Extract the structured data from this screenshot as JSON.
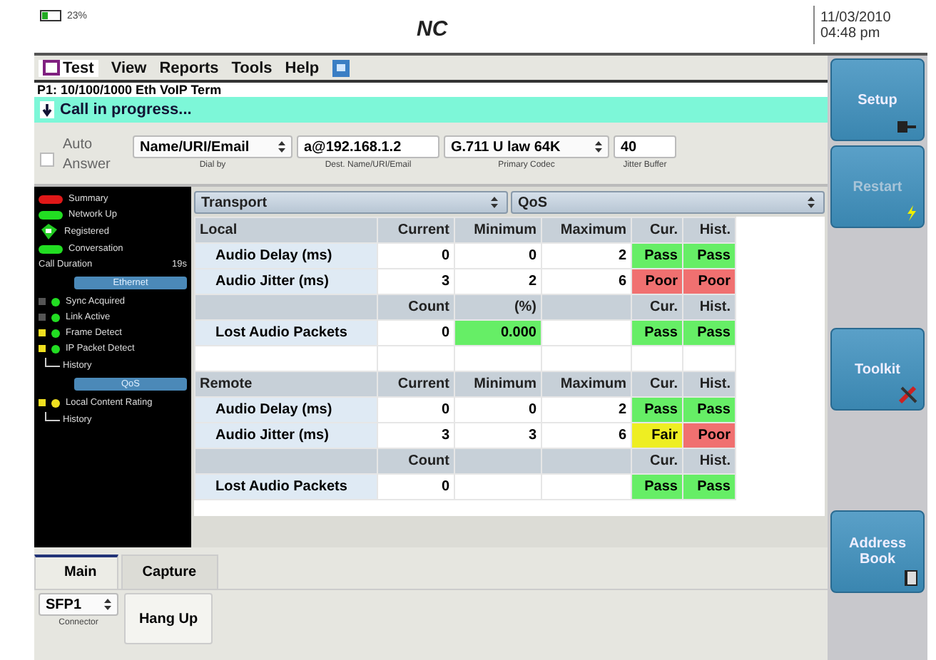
{
  "top_bar": {
    "battery": "23%",
    "logo": "NC",
    "date": "11/03/2010",
    "time": "04:48 pm"
  },
  "menu": [
    {
      "label": "Test",
      "selected": true
    },
    {
      "label": "View",
      "selected": false
    },
    {
      "label": "Reports",
      "selected": false
    },
    {
      "label": "Tools",
      "selected": false
    },
    {
      "label": "Help",
      "selected": false
    }
  ],
  "title": "P1: 10/100/1000 Eth VoIP Term",
  "status": "Call in progress...",
  "form": {
    "auto_answer": {
      "label": "Auto Answer",
      "checked": false
    },
    "fields": [
      {
        "kind": "select",
        "value": "Name/URI/Email",
        "caption": "Dial by"
      },
      {
        "kind": "text",
        "value": "a@192.168.1.2",
        "caption": "Dest. Name/URI/Email"
      },
      {
        "kind": "select",
        "value": "G.711 U law 64K",
        "caption": "Primary Codec"
      },
      {
        "kind": "text",
        "value": "40",
        "caption": "Jitter Buffer"
      }
    ]
  },
  "sidebar": [
    {
      "kind": "pill",
      "label": "Summary",
      "color": "#e01818"
    },
    {
      "kind": "pill",
      "label": "Network Up",
      "color": "#22dd22"
    },
    {
      "kind": "phone",
      "label": "Registered"
    },
    {
      "kind": "pill",
      "label": "Conversation",
      "color": "#22dd22"
    },
    {
      "kind": "value",
      "label": "Call Duration",
      "value": "19s"
    },
    {
      "kind": "section",
      "label": "Ethernet"
    },
    {
      "kind": "led",
      "label": "Sync Acquired",
      "history_alarm": false,
      "color": "#22dd22"
    },
    {
      "kind": "led",
      "label": "Link Active",
      "history_alarm": false,
      "color": "#22dd22"
    },
    {
      "kind": "led",
      "label": "Frame Detect",
      "history_alarm": true,
      "color": "#22dd22"
    },
    {
      "kind": "led",
      "label": "IP Packet Detect",
      "history_alarm": true,
      "color": "#22dd22"
    },
    {
      "kind": "history",
      "label": "History"
    },
    {
      "kind": "section",
      "label": "QoS"
    },
    {
      "kind": "led",
      "label": "Local Content Rating",
      "history_alarm": true,
      "color": "#f0e020"
    },
    {
      "kind": "history",
      "label": "History"
    }
  ],
  "selectors": [
    "Transport",
    "QoS"
  ],
  "table": {
    "rows": [
      {
        "kind": "header",
        "cells": [
          "Local",
          "Current",
          "Minimum",
          "Maximum",
          "Cur.",
          "Hist."
        ]
      },
      {
        "kind": "data",
        "cells": [
          "Audio Delay (ms)",
          "0",
          "0",
          "2"
        ],
        "results": [
          {
            "text": "Pass",
            "color": "#66ee66"
          },
          {
            "text": "Pass",
            "color": "#66ee66"
          }
        ]
      },
      {
        "kind": "data",
        "cells": [
          "Audio Jitter (ms)",
          "3",
          "2",
          "6"
        ],
        "results": [
          {
            "text": "Poor",
            "color": "#f07070"
          },
          {
            "text": "Poor",
            "color": "#f07070"
          }
        ]
      },
      {
        "kind": "header",
        "cells": [
          "",
          "Count",
          "(%)",
          "",
          "Cur.",
          "Hist."
        ]
      },
      {
        "kind": "data",
        "cells": [
          "Lost Audio Packets",
          "0",
          "0.000",
          ""
        ],
        "percent_pass": true,
        "results": [
          {
            "text": "Pass",
            "color": "#66ee66"
          },
          {
            "text": "Pass",
            "color": "#66ee66"
          }
        ]
      },
      {
        "kind": "blank",
        "cells": []
      },
      {
        "kind": "header",
        "cells": [
          "Remote",
          "Current",
          "Minimum",
          "Maximum",
          "Cur.",
          "Hist."
        ]
      },
      {
        "kind": "data",
        "cells": [
          "Audio Delay (ms)",
          "0",
          "0",
          "2"
        ],
        "results": [
          {
            "text": "Pass",
            "color": "#66ee66"
          },
          {
            "text": "Pass",
            "color": "#66ee66"
          }
        ]
      },
      {
        "kind": "data",
        "cells": [
          "Audio Jitter (ms)",
          "3",
          "3",
          "6"
        ],
        "results": [
          {
            "text": "Fair",
            "color": "#eeee22"
          },
          {
            "text": "Poor",
            "color": "#f07070"
          }
        ]
      },
      {
        "kind": "header",
        "cells": [
          "",
          "Count",
          "",
          "",
          "Cur.",
          "Hist."
        ]
      },
      {
        "kind": "data",
        "cells": [
          "Lost Audio Packets",
          "0",
          "",
          ""
        ],
        "results": [
          {
            "text": "Pass",
            "color": "#66ee66"
          },
          {
            "text": "Pass",
            "color": "#66ee66"
          }
        ]
      }
    ]
  },
  "bottom_tabs": [
    {
      "label": "Main",
      "selected": true
    },
    {
      "label": "Capture",
      "selected": false
    }
  ],
  "connector": {
    "value": "SFP1",
    "caption": "Connector"
  },
  "hang_up": "Hang Up",
  "side_buttons": [
    {
      "label": "Setup",
      "disabled": false
    },
    {
      "label": "Restart",
      "disabled": true
    },
    {
      "label": "Toolkit",
      "disabled": false
    },
    {
      "label": "Address Book",
      "disabled": false
    }
  ]
}
